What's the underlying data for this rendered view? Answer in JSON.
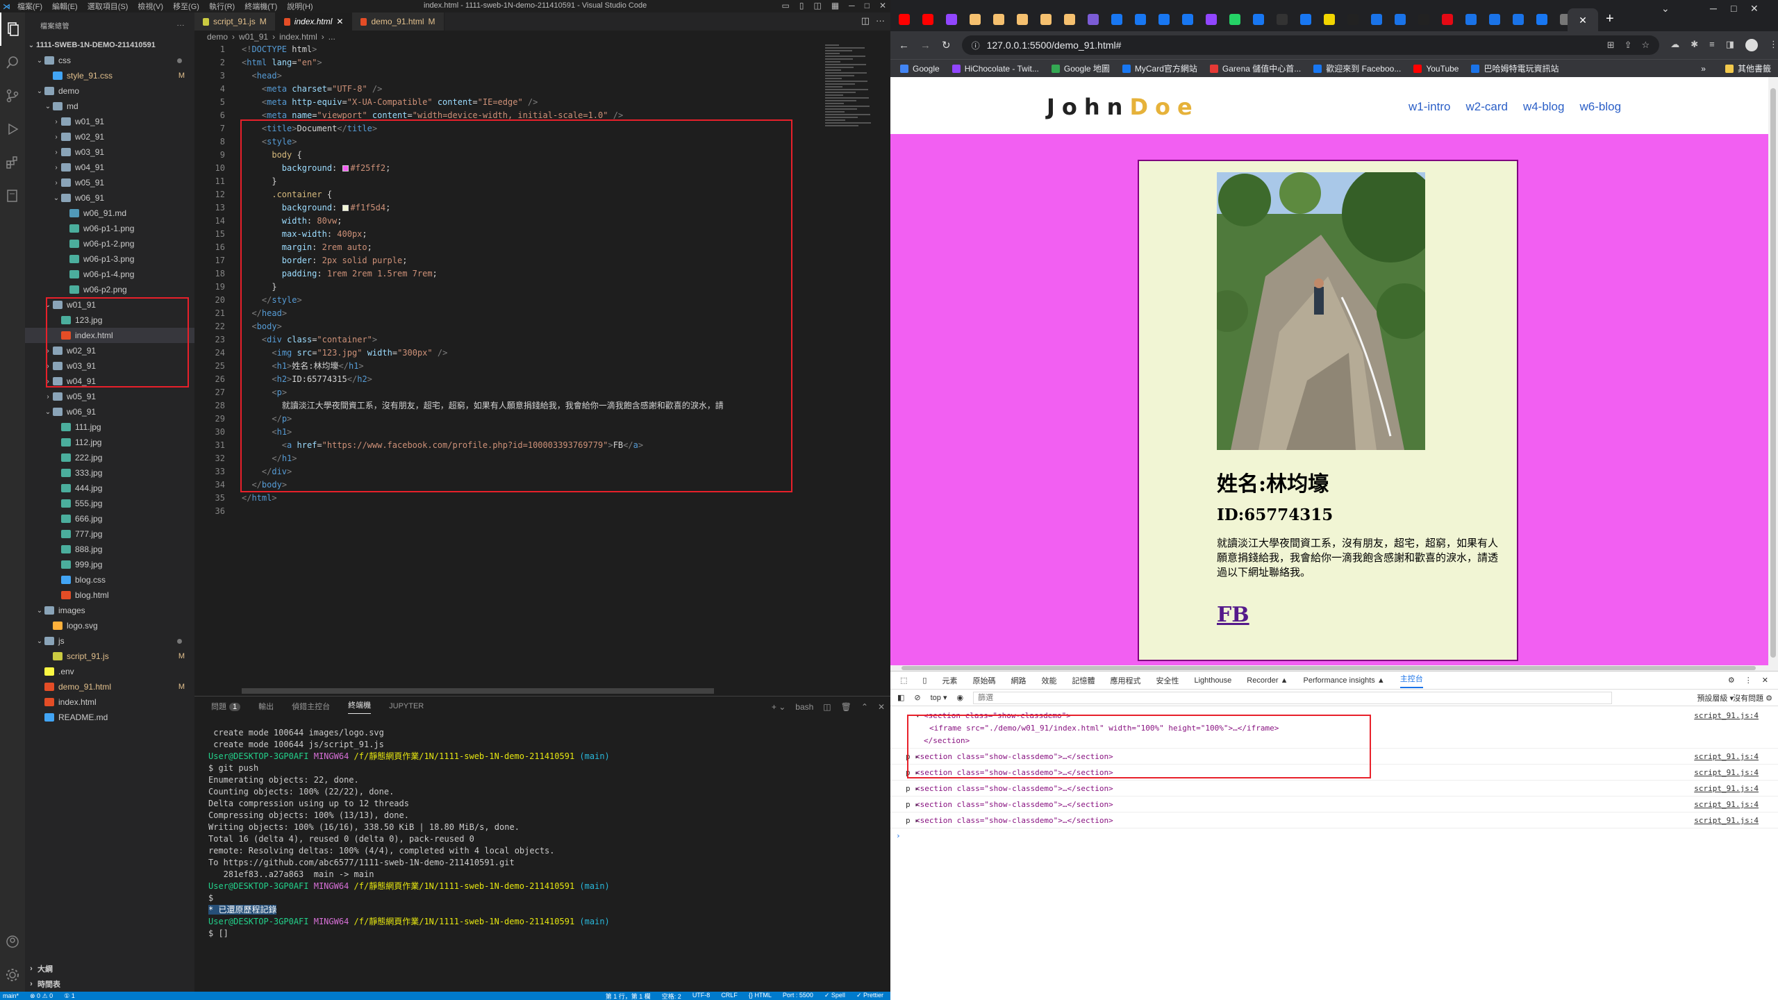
{
  "vscode": {
    "titlebar": {
      "menu": [
        "檔案(F)",
        "編輯(E)",
        "選取項目(S)",
        "檢視(V)",
        "移至(G)",
        "執行(R)",
        "終端機(T)",
        "說明(H)"
      ],
      "window_title": "index.html - 1111-sweb-1N-demo-211410591 - Visual Studio Code"
    },
    "explorer": {
      "header": "檔案總管",
      "root": "1111-SWEB-1N-DEMO-211410591",
      "items": [
        {
          "label": "css",
          "type": "folder",
          "depth": 1,
          "open": true,
          "dot": true
        },
        {
          "label": "style_91.css",
          "type": "css",
          "depth": 2,
          "badge": "M"
        },
        {
          "label": "demo",
          "type": "folder",
          "depth": 1,
          "open": true
        },
        {
          "label": "md",
          "type": "folder",
          "depth": 2,
          "open": true
        },
        {
          "label": "w01_91",
          "type": "folder",
          "depth": 3
        },
        {
          "label": "w02_91",
          "type": "folder",
          "depth": 3
        },
        {
          "label": "w03_91",
          "type": "folder",
          "depth": 3
        },
        {
          "label": "w04_91",
          "type": "folder",
          "depth": 3
        },
        {
          "label": "w05_91",
          "type": "folder",
          "depth": 3
        },
        {
          "label": "w06_91",
          "type": "folder",
          "depth": 3,
          "open": true
        },
        {
          "label": "w06_91.md",
          "type": "md",
          "depth": 4
        },
        {
          "label": "w06-p1-1.png",
          "type": "img",
          "depth": 4
        },
        {
          "label": "w06-p1-2.png",
          "type": "img",
          "depth": 4
        },
        {
          "label": "w06-p1-3.png",
          "type": "img",
          "depth": 4
        },
        {
          "label": "w06-p1-4.png",
          "type": "img",
          "depth": 4
        },
        {
          "label": "w06-p2.png",
          "type": "img",
          "depth": 4
        },
        {
          "label": "w01_91",
          "type": "folder",
          "depth": 2,
          "open": true
        },
        {
          "label": "123.jpg",
          "type": "img",
          "depth": 3
        },
        {
          "label": "index.html",
          "type": "html",
          "depth": 3,
          "selected": true
        },
        {
          "label": "w02_91",
          "type": "folder",
          "depth": 2
        },
        {
          "label": "w03_91",
          "type": "folder",
          "depth": 2
        },
        {
          "label": "w04_91",
          "type": "folder",
          "depth": 2
        },
        {
          "label": "w05_91",
          "type": "folder",
          "depth": 2
        },
        {
          "label": "w06_91",
          "type": "folder",
          "depth": 2,
          "open": true
        },
        {
          "label": "111.jpg",
          "type": "img",
          "depth": 3
        },
        {
          "label": "112.jpg",
          "type": "img",
          "depth": 3
        },
        {
          "label": "222.jpg",
          "type": "img",
          "depth": 3
        },
        {
          "label": "333.jpg",
          "type": "img",
          "depth": 3
        },
        {
          "label": "444.jpg",
          "type": "img",
          "depth": 3
        },
        {
          "label": "555.jpg",
          "type": "img",
          "depth": 3
        },
        {
          "label": "666.jpg",
          "type": "img",
          "depth": 3
        },
        {
          "label": "777.jpg",
          "type": "img",
          "depth": 3
        },
        {
          "label": "888.jpg",
          "type": "img",
          "depth": 3
        },
        {
          "label": "999.jpg",
          "type": "img",
          "depth": 3
        },
        {
          "label": "blog.css",
          "type": "css",
          "depth": 3
        },
        {
          "label": "blog.html",
          "type": "html",
          "depth": 3
        },
        {
          "label": "images",
          "type": "folder",
          "depth": 1,
          "open": true
        },
        {
          "label": "logo.svg",
          "type": "svg",
          "depth": 2
        },
        {
          "label": "js",
          "type": "folder",
          "depth": 1,
          "open": true,
          "dot": true
        },
        {
          "label": "script_91.js",
          "type": "js",
          "depth": 2,
          "badge": "M"
        },
        {
          "label": ".env",
          "type": "env",
          "depth": 1
        },
        {
          "label": "demo_91.html",
          "type": "html",
          "depth": 1,
          "badge": "M"
        },
        {
          "label": "index.html",
          "type": "html",
          "depth": 1
        },
        {
          "label": "README.md",
          "type": "info",
          "depth": 1
        }
      ],
      "outline": "大綱",
      "timeline": "時間表"
    },
    "tabs": [
      {
        "label": "script_91.js",
        "mod": "M",
        "kind": "js"
      },
      {
        "label": "index.html",
        "mod": "",
        "kind": "html",
        "active": true
      },
      {
        "label": "demo_91.html",
        "mod": "M",
        "kind": "html"
      }
    ],
    "breadcrumb": [
      "demo",
      "w01_91",
      "index.html",
      "..."
    ],
    "code_lines": [
      "<!DOCTYPE html>",
      "<html lang=\"en\">",
      "  <head>",
      "    <meta charset=\"UTF-8\" />",
      "    <meta http-equiv=\"X-UA-Compatible\" content=\"IE=edge\" />",
      "    <meta name=\"viewport\" content=\"width=device-width, initial-scale=1.0\" />",
      "    <title>Document</title>",
      "    <style>",
      "      body {",
      "        background: #f25ff2;",
      "      }",
      "      .container {",
      "        background: #f1f5d4;",
      "        width: 80vw;",
      "        max-width: 400px;",
      "        margin: 2rem auto;",
      "        border: 2px solid purple;",
      "        padding: 1rem 2rem 1.5rem 7rem;",
      "      }",
      "    </style>",
      "  </head>",
      "  <body>",
      "    <div class=\"container\">",
      "      <img src=\"123.jpg\" width=\"300px\" />",
      "      <h1>姓名:林均壕</h1>",
      "      <h2>ID:65774315</h2>",
      "      <p>",
      "        就讀淡江大學夜間資工系，沒有朋友，超宅，超窮，如果有人願意捐錢給我，我會給你一滴我飽含感謝和歡喜的淚水，請",
      "      </p>",
      "      <h1>",
      "        <a href=\"https://www.facebook.com/profile.php?id=100003393769779\">FB</a>",
      "      </h1>",
      "    </div>",
      "  </body>",
      "</html>",
      ""
    ],
    "panel": {
      "tabs": [
        "問題",
        "輸出",
        "偵錯主控台",
        "終端機",
        "JUPYTER"
      ],
      "problems_count": "1",
      "shell": "bash",
      "terminal": [
        " create mode 100644 images/logo.svg",
        " create mode 100644 js/script_91.js",
        "",
        "User@DESKTOP-3GP0AFI MINGW64 /f/靜態網頁作業/1N/1111-sweb-1N-demo-211410591 (main)",
        "$ git push",
        "Enumerating objects: 22, done.",
        "Counting objects: 100% (22/22), done.",
        "Delta compression using up to 12 threads",
        "Compressing objects: 100% (13/13), done.",
        "Writing objects: 100% (16/16), 338.50 KiB | 18.80 MiB/s, done.",
        "Total 16 (delta 4), reused 0 (delta 0), pack-reused 0",
        "remote: Resolving deltas: 100% (4/4), completed with 4 local objects.",
        "To https://github.com/abc6577/1111-sweb-1N-demo-211410591.git",
        "   281ef83..a27a863  main -> main",
        "",
        "User@DESKTOP-3GP0AFI MINGW64 /f/靜態網頁作業/1N/1111-sweb-1N-demo-211410591 (main)",
        "$",
        "* 已還原歷程記錄",
        "",
        "",
        "User@DESKTOP-3GP0AFI MINGW64 /f/靜態網頁作業/1N/1111-sweb-1N-demo-211410591 (main)",
        "$ []"
      ]
    },
    "statusbar": {
      "left": [
        "main*",
        "⊗ 0 ⚠ 0",
        "① 1"
      ],
      "right": [
        "第 1 行，第 1 欄",
        "空格: 2",
        "UTF-8",
        "CRLF",
        "{} HTML",
        "Port : 5500",
        "✓ Spell",
        "✓ Prettier"
      ]
    }
  },
  "chrome": {
    "url": "127.0.0.1:5500/demo_91.html#",
    "bookmarks": [
      "Google",
      "HiChocolate - Twit...",
      "Google 地圖",
      "MyCard官方網站",
      "Garena 儲值中心首...",
      "歡迎來到 Faceboo...",
      "YouTube",
      "巴哈姆特電玩資訊站"
    ],
    "other_bookmarks": "其他書籤",
    "page": {
      "logo_main": "John",
      "logo_accent": "Doe",
      "nav": [
        "w1-intro",
        "w2-card",
        "w4-blog",
        "w6-blog"
      ],
      "name": "姓名:林均壕",
      "id": "ID:65774315",
      "bio": "就讀淡江大學夜間資工系，沒有朋友，超宅，超窮，如果有人願意捐錢給我，我會給你一滴我飽含感謝和歡喜的淚水，請透過以下網址聯絡我。",
      "link": "FB"
    },
    "devtools": {
      "tabs": [
        "元素",
        "原始碼",
        "網路",
        "效能",
        "記憶體",
        "應用程式",
        "安全性",
        "Lighthouse",
        "Recorder ▲",
        "Performance insights ▲",
        "主控台"
      ],
      "context": "top",
      "filter_placeholder": "篩選",
      "levels": "預設層級 ▾",
      "no_issues": "沒有問題",
      "source": "script_91.js:4",
      "rows": [
        {
          "line1": "<section class=\"show-classdemo\">",
          "line2": "<iframe src=\"./demo/w01_91/index.html\" width=\"100%\" height=\"100%\">…</iframe>",
          "line3": "</section>"
        },
        {
          "line1": "<section class=\"show-classdemo\">…</section>"
        },
        {
          "line1": "<section class=\"show-classdemo\">…</section>"
        },
        {
          "line1": "<section class=\"show-classdemo\">…</section>"
        },
        {
          "line1": "<section class=\"show-classdemo\">…</section>"
        },
        {
          "line1": "<section class=\"show-classdemo\">…</section>"
        }
      ]
    }
  }
}
